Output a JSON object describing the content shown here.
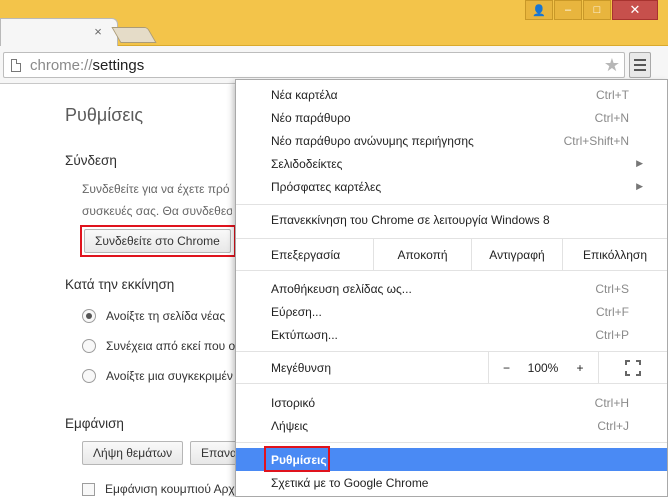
{
  "tab": {
    "close_glyph": "×"
  },
  "window": {
    "user_glyph": "👤",
    "min_glyph": "–",
    "max_glyph": "□",
    "close_glyph": "✕"
  },
  "omnibox": {
    "scheme": "chrome://",
    "host": "settings",
    "star_glyph": "★"
  },
  "settings": {
    "title": "Ρυθμίσεις",
    "signin": {
      "heading": "Σύνδεση",
      "desc1": "Συνδεθείτε για να έχετε πρό",
      "desc2": "συσκευές σας. Θα συνδεθεστ",
      "button": "Συνδεθείτε στο Chrome"
    },
    "startup": {
      "heading": "Κατά την εκκίνηση",
      "options": [
        {
          "label": "Ανοίξτε τη σελίδα νέας",
          "selected": true
        },
        {
          "label": "Συνέχεια από εκεί που ο",
          "selected": false
        },
        {
          "label": "Ανοίξτε μια συγκεκριμέν",
          "selected": false
        }
      ]
    },
    "appearance": {
      "heading": "Εμφάνιση",
      "button1": "Λήψη θεμάτων",
      "button2": "Επανα",
      "checkbox": "Εμφάνιση κουμπιού Αρχ"
    }
  },
  "menu": {
    "items": [
      {
        "label": "Νέα καρτέλα",
        "shortcut": "Ctrl+T"
      },
      {
        "label": "Νέο παράθυρο",
        "shortcut": "Ctrl+N"
      },
      {
        "label": "Νέο παράθυρο ανώνυμης περιήγησης",
        "shortcut": "Ctrl+Shift+N"
      },
      {
        "label": "Σελιδοδείκτες",
        "arrow": "▶"
      },
      {
        "label": "Πρόσφατες καρτέλες",
        "arrow": "▶"
      }
    ],
    "relaunch": "Επανεκκίνηση του Chrome σε λειτουργία Windows 8",
    "edit": {
      "label": "Επεξεργασία",
      "cut": "Αποκοπή",
      "copy": "Αντιγραφή",
      "paste": "Επικόλληση"
    },
    "page_items": [
      {
        "label": "Αποθήκευση σελίδας ως...",
        "shortcut": "Ctrl+S"
      },
      {
        "label": "Εύρεση...",
        "shortcut": "Ctrl+F"
      },
      {
        "label": "Εκτύπωση...",
        "shortcut": "Ctrl+P"
      }
    ],
    "zoom": {
      "label": "Μεγέθυνση",
      "minus": "−",
      "value": "100%",
      "plus": "+"
    },
    "history": {
      "label": "Ιστορικό",
      "shortcut": "Ctrl+H"
    },
    "downloads": {
      "label": "Λήψεις",
      "shortcut": "Ctrl+J"
    },
    "settings": "Ρυθμίσεις",
    "about": "Σχετικά με το Google Chrome"
  },
  "colors": {
    "highlight": "#4a8af4",
    "annotation_red": "#e0131d",
    "frame": "#f3c44a"
  }
}
